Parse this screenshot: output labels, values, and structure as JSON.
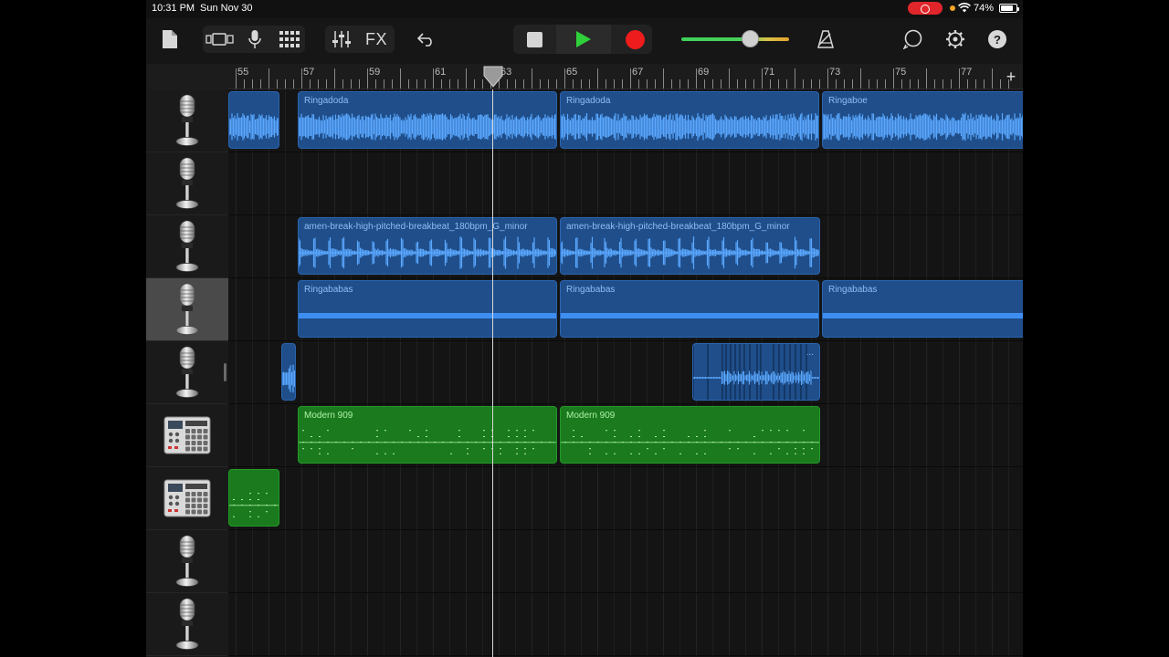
{
  "status_bar": {
    "time": "10:31 PM",
    "date": "Sun Nov 30",
    "battery": "74%"
  },
  "toolbar": {
    "browser_icon": "document-icon",
    "view_toggle_icon": "track-view-icon",
    "mic_icon": "microphone-icon",
    "grid_icon": "grid-icon",
    "mixer_icon": "mixer-icon",
    "fx_label": "FX",
    "undo_icon": "undo-icon",
    "stop_icon": "stop-icon",
    "play_icon": "play-icon",
    "record_icon": "record-icon",
    "metronome_icon": "metronome-icon",
    "loop_icon": "loop-icon",
    "settings_icon": "gear-icon",
    "help_label": "?",
    "master_volume": 0.6
  },
  "ruler": {
    "bars": [
      "55",
      "57",
      "59",
      "61",
      "63",
      "65",
      "67",
      "69",
      "71",
      "73",
      "75",
      "77"
    ],
    "add_label": "+"
  },
  "tracks": [
    {
      "instrument": "microphone",
      "regions": [
        {
          "label": ""
        },
        {
          "label": "Ringadoda"
        },
        {
          "label": "Ringadoda"
        },
        {
          "label": "Ringaboe"
        }
      ]
    },
    {
      "instrument": "microphone",
      "regions": []
    },
    {
      "instrument": "microphone",
      "regions": [
        {
          "label": "amen-break-high-pitched-breakbeat_180bpm_G_minor"
        },
        {
          "label": "amen-break-high-pitched-breakbeat_180bpm_G_minor"
        }
      ]
    },
    {
      "instrument": "microphone",
      "selected": true,
      "regions": [
        {
          "label": "Ringababas"
        },
        {
          "label": "Ringababas"
        },
        {
          "label": "Ringababas"
        }
      ]
    },
    {
      "instrument": "microphone",
      "regions": [
        {
          "label": ""
        },
        {
          "label": "..."
        }
      ]
    },
    {
      "instrument": "drum-machine",
      "regions": [
        {
          "label": "Modern 909"
        },
        {
          "label": "Modern 909"
        }
      ]
    },
    {
      "instrument": "drum-machine",
      "regions": [
        {
          "label": ""
        }
      ]
    },
    {
      "instrument": "microphone",
      "regions": []
    },
    {
      "instrument": "microphone",
      "regions": []
    }
  ],
  "colors": {
    "audio_region": "#1f4e8a",
    "waveform": "#5aa8ff",
    "drum_region": "#1a7a1d",
    "record": "#ee1c1c",
    "play": "#2fd13a"
  }
}
